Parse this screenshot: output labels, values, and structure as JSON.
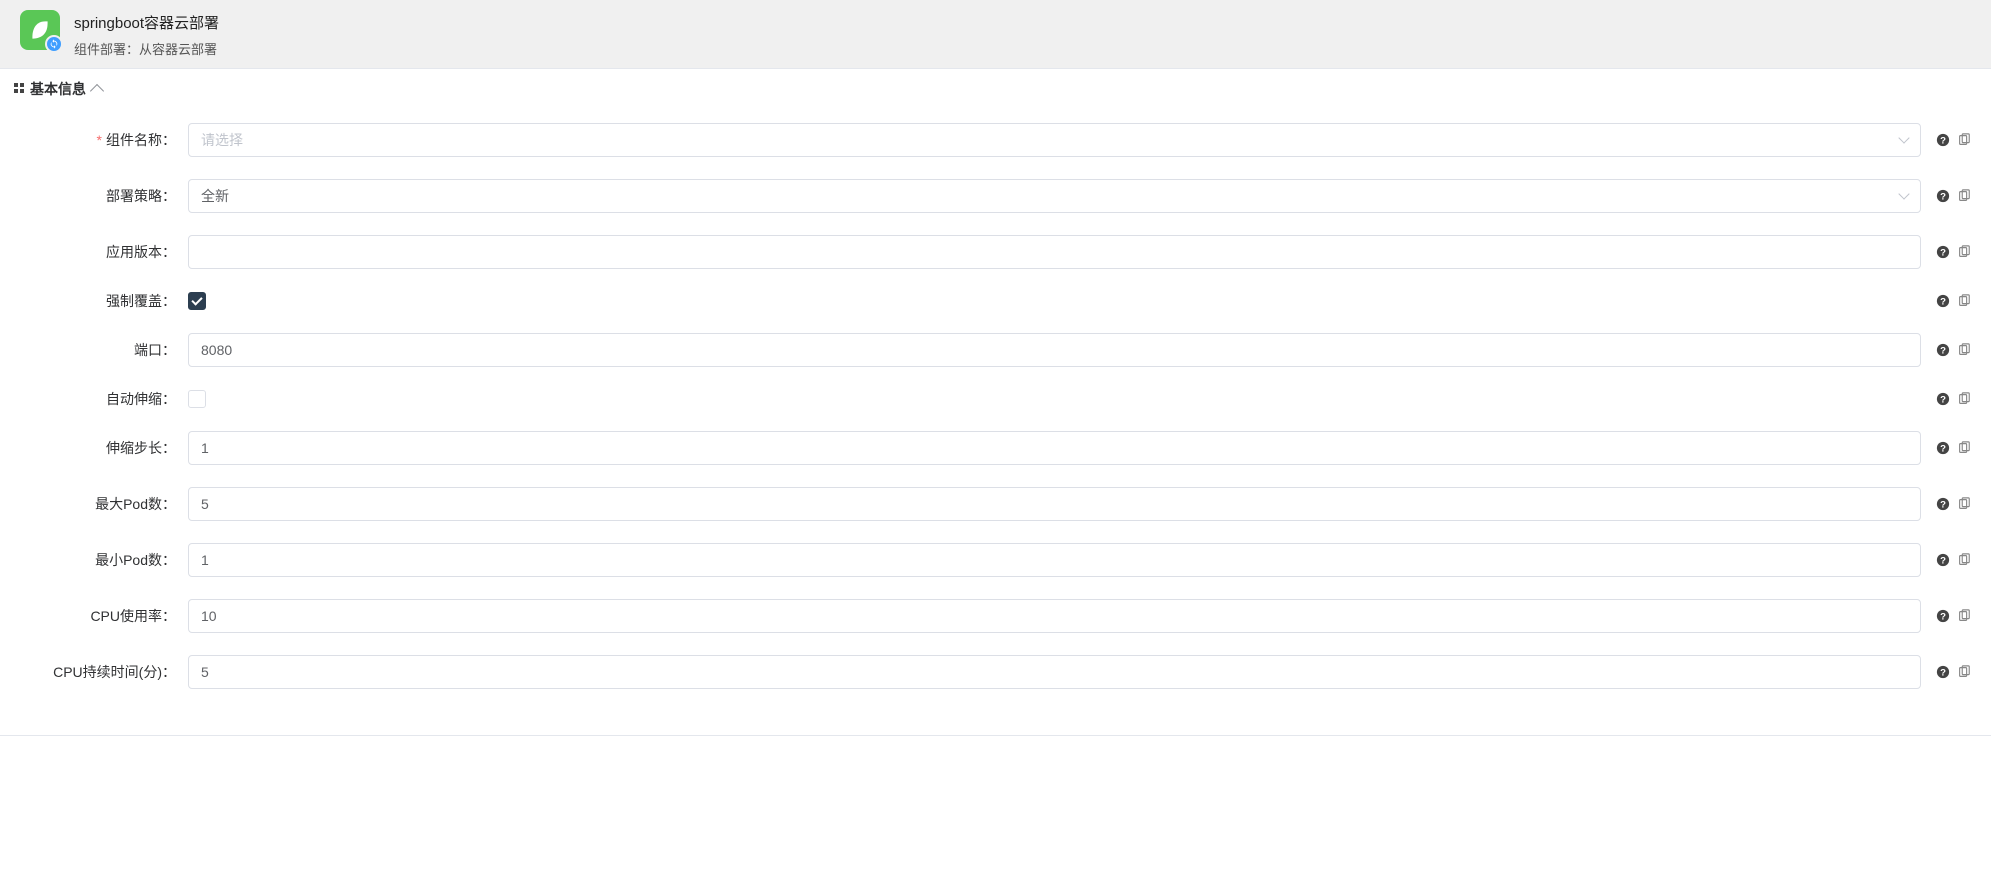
{
  "header": {
    "title": "springboot容器云部署",
    "subtitle": "组件部署：从容器云部署"
  },
  "section": {
    "title": "基本信息"
  },
  "form": {
    "componentName": {
      "label": "组件名称：",
      "placeholder": "请选择",
      "required": true
    },
    "deployStrategy": {
      "label": "部署策略：",
      "value": "全新"
    },
    "appVersion": {
      "label": "应用版本：",
      "value": ""
    },
    "forceOverride": {
      "label": "强制覆盖：",
      "checked": true
    },
    "port": {
      "label": "端口：",
      "value": "8080"
    },
    "autoScale": {
      "label": "自动伸缩：",
      "checked": false
    },
    "scaleStep": {
      "label": "伸缩步长：",
      "value": "1"
    },
    "maxPod": {
      "label": "最大Pod数：",
      "value": "5"
    },
    "minPod": {
      "label": "最小Pod数：",
      "value": "1"
    },
    "cpuUsage": {
      "label": "CPU使用率：",
      "value": "10"
    },
    "cpuDuration": {
      "label": "CPU持续时间(分)：",
      "value": "5"
    }
  }
}
